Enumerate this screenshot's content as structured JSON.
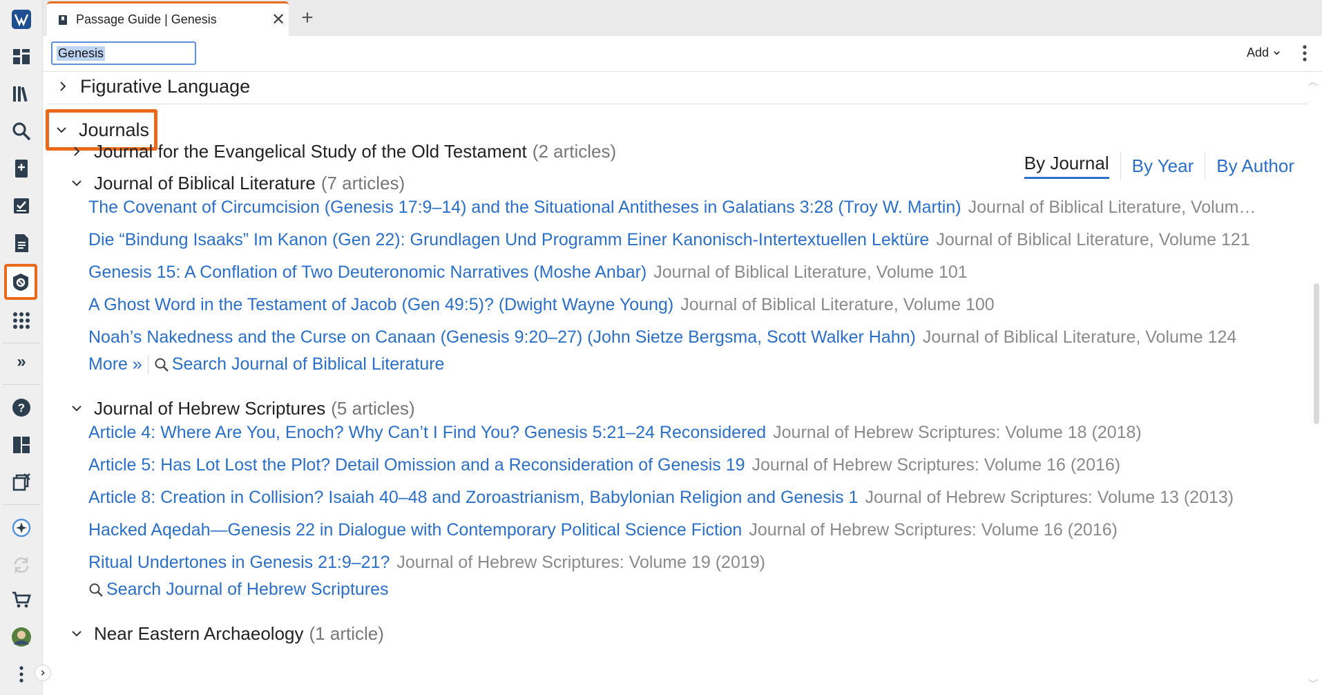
{
  "tab": {
    "title": "Passage Guide | Genesis",
    "close": "✕",
    "add": "+"
  },
  "toolbar": {
    "reference": "Genesis",
    "add_label": "Add"
  },
  "sections": {
    "figurative": "Figurative Language",
    "journals": "Journals"
  },
  "view_tabs": [
    "By Journal",
    "By Year",
    "By Author"
  ],
  "journals": [
    {
      "name": "Journal for the Evangelical Study of the Old Testament",
      "count": "(2 articles)"
    },
    {
      "name": "Journal of Biblical Literature",
      "count": "(7 articles)",
      "articles": [
        {
          "title": "The Covenant of Circumcision (Genesis 17:9–14) and the Situational Antitheses in Galatians 3:28 (Troy W. Martin)",
          "source": "Journal of Biblical Literature, Volum…"
        },
        {
          "title": "Die “Bindung Isaaks” Im Kanon (Gen 22): Grundlagen Und Programm Einer Kanonisch-Intertextuellen Lektüre",
          "source": "Journal of Biblical Literature, Volume 121"
        },
        {
          "title": "Genesis 15: A Conflation of Two Deuteronomic Narratives (Moshe Anbar)",
          "source": "Journal of Biblical Literature, Volume 101"
        },
        {
          "title": "A Ghost Word in the Testament of Jacob (Gen 49:5)? (Dwight Wayne Young)",
          "source": "Journal of Biblical Literature, Volume 100"
        },
        {
          "title": "Noah’s Nakedness and the Curse on Canaan (Genesis 9:20–27) (John Sietze Bergsma, Scott Walker Hahn)",
          "source": "Journal of Biblical Literature, Volume 124"
        }
      ],
      "more": "More »",
      "search": "Search Journal of Biblical Literature"
    },
    {
      "name": "Journal of Hebrew Scriptures",
      "count": "(5 articles)",
      "articles": [
        {
          "title": "Article 4: Where Are You, Enoch? Why Can’t I Find You? Genesis 5:21–24 Reconsidered",
          "source": "Journal of Hebrew Scriptures: Volume 18 (2018)"
        },
        {
          "title": "Article 5: Has Lot Lost the Plot? Detail Omission and a Reconsideration of Genesis 19",
          "source": "Journal of Hebrew Scriptures: Volume 16 (2016)"
        },
        {
          "title": "Article 8: Creation in Collision? Isaiah 40–48 and Zoroastrianism, Babylonian Religion and Genesis 1",
          "source": "Journal of Hebrew Scriptures: Volume 13 (2013)"
        },
        {
          "title": "Hacked Aqedah—Genesis 22 in Dialogue with Contemporary Political Science Fiction",
          "source": "Journal of Hebrew Scriptures: Volume 16 (2016)"
        },
        {
          "title": "Ritual Undertones in Genesis 21:9–21?",
          "source": "Journal of Hebrew Scriptures: Volume 19 (2019)"
        }
      ],
      "search": "Search Journal of Hebrew Scriptures"
    },
    {
      "name": "Near Eastern Archaeology",
      "count": "(1 article)"
    }
  ],
  "rail": {
    "expand": "»",
    "help": "?",
    "icons": [
      "logos-logo-icon",
      "dashboard-icon",
      "library-icon",
      "search-icon",
      "bible-add-icon",
      "checklist-icon",
      "document-icon",
      "passage-guide-icon",
      "apps-grid-icon",
      "help-icon",
      "layouts-icon",
      "close-panels-icon",
      "ai-spark-icon",
      "sync-icon",
      "cart-icon",
      "avatar",
      "more-vertical-icon"
    ]
  },
  "colors": {
    "accent": "#ea6a1b",
    "link": "#2a6fc9",
    "secondary_text": "#8a8a8a"
  }
}
